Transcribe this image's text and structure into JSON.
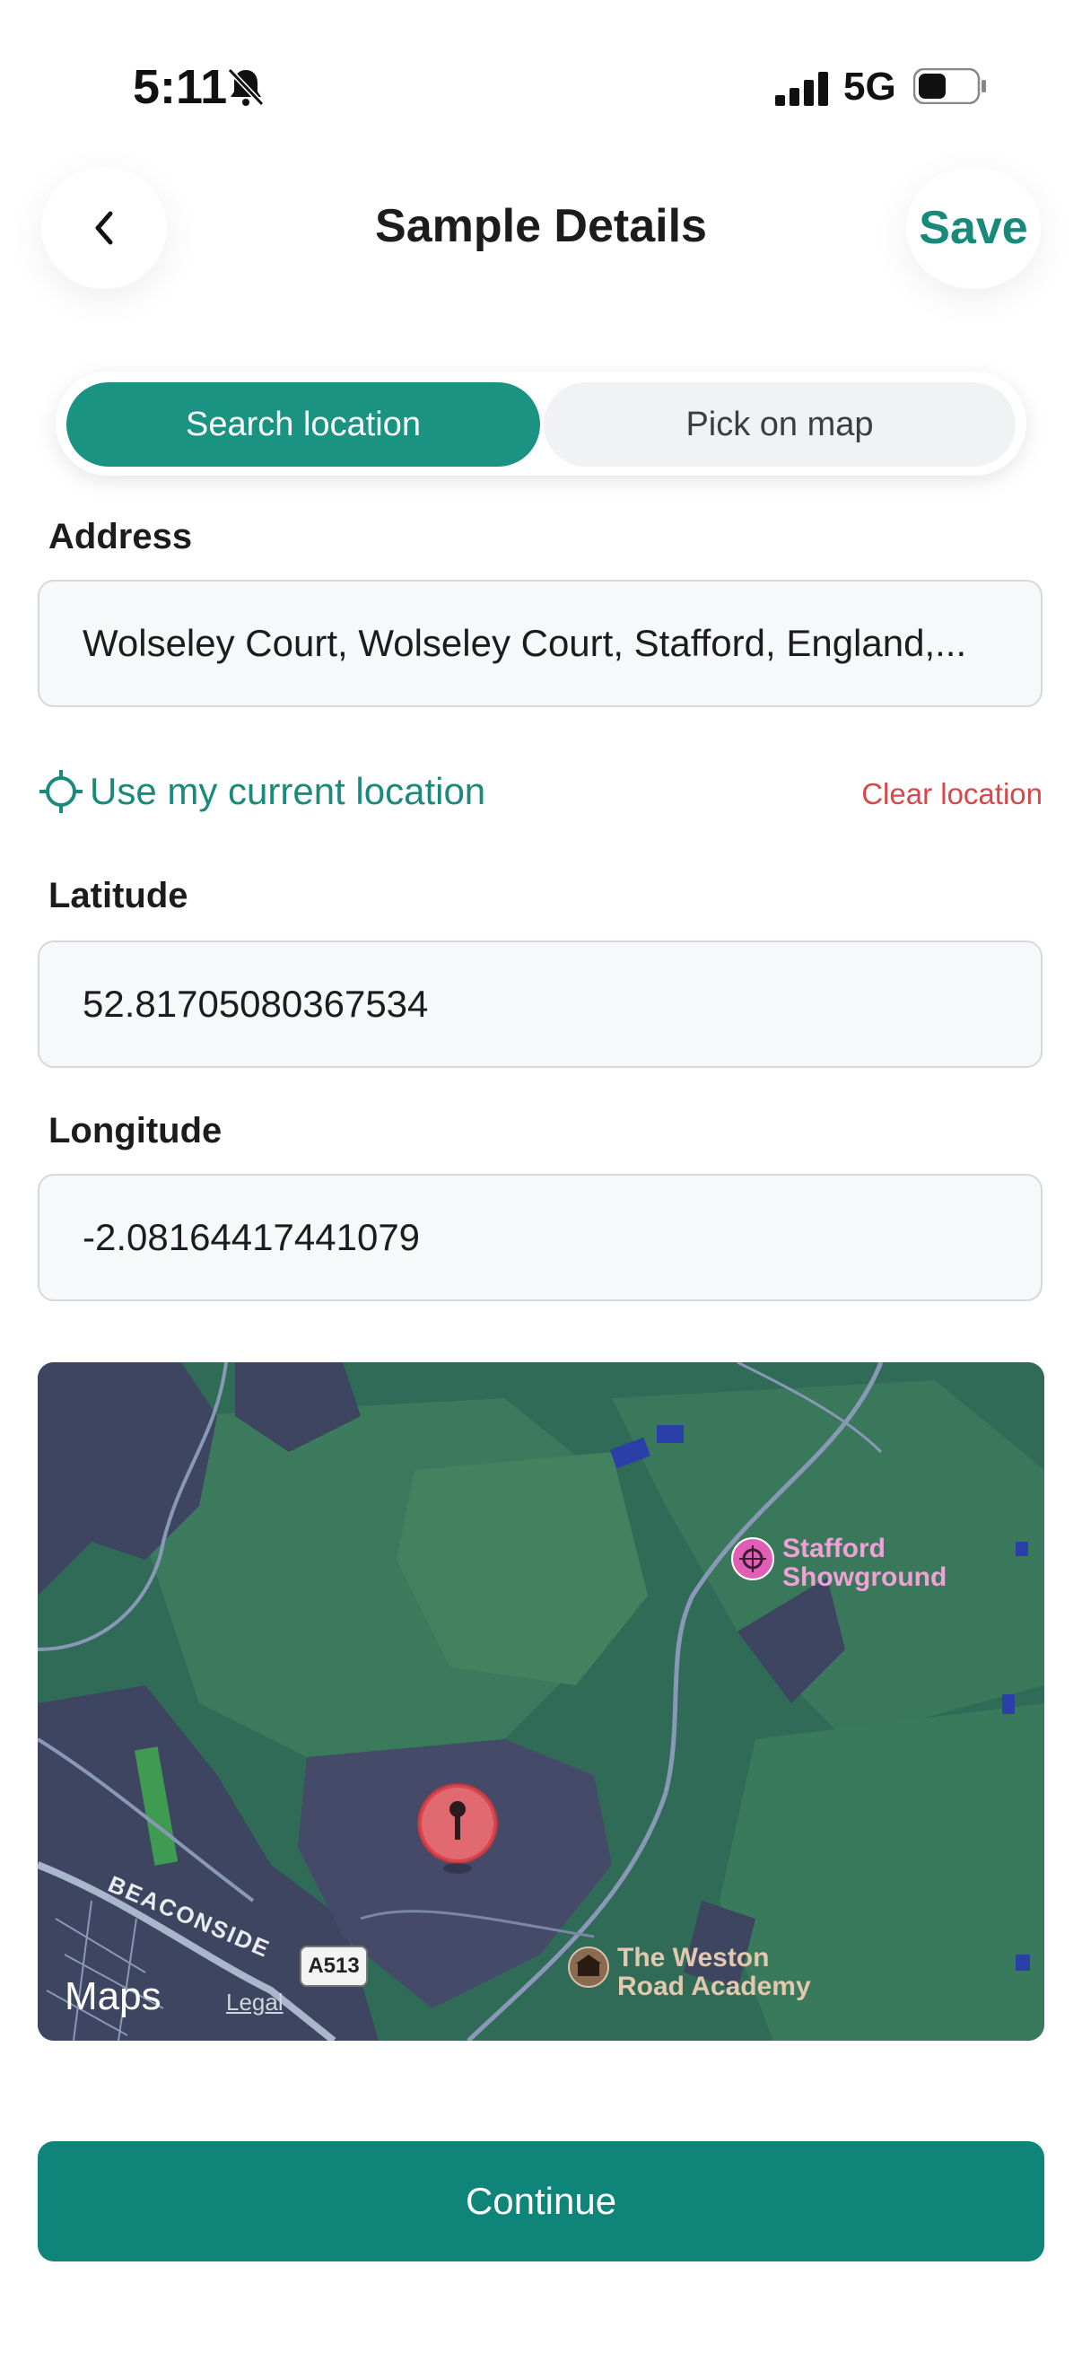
{
  "status_bar": {
    "time": "5:11",
    "network": "5G"
  },
  "header": {
    "title": "Sample Details",
    "save_label": "Save"
  },
  "segmented": {
    "search_label": "Search location",
    "pick_label": "Pick on map",
    "selected": "Search location"
  },
  "address": {
    "label": "Address",
    "value": "Wolseley Court, Wolseley Court, Stafford, England,..."
  },
  "location_actions": {
    "use_current": "Use my current location",
    "clear": "Clear location"
  },
  "latitude": {
    "label": "Latitude",
    "value": "52.81705080367534"
  },
  "longitude": {
    "label": "Longitude",
    "value": "-2.08164417441079"
  },
  "map": {
    "poi_showground_line1": "Stafford",
    "poi_showground_line2": "Showground",
    "poi_academy_line1": "The Weston",
    "poi_academy_line2": "Road Academy",
    "road_name": "BEACONSIDE",
    "road_shield": "A513",
    "attribution": "Maps",
    "legal": "Legal"
  },
  "footer": {
    "continue_label": "Continue"
  },
  "colors": {
    "accent": "#1a9383",
    "danger": "#d94848",
    "primary_button": "#0f8478"
  }
}
